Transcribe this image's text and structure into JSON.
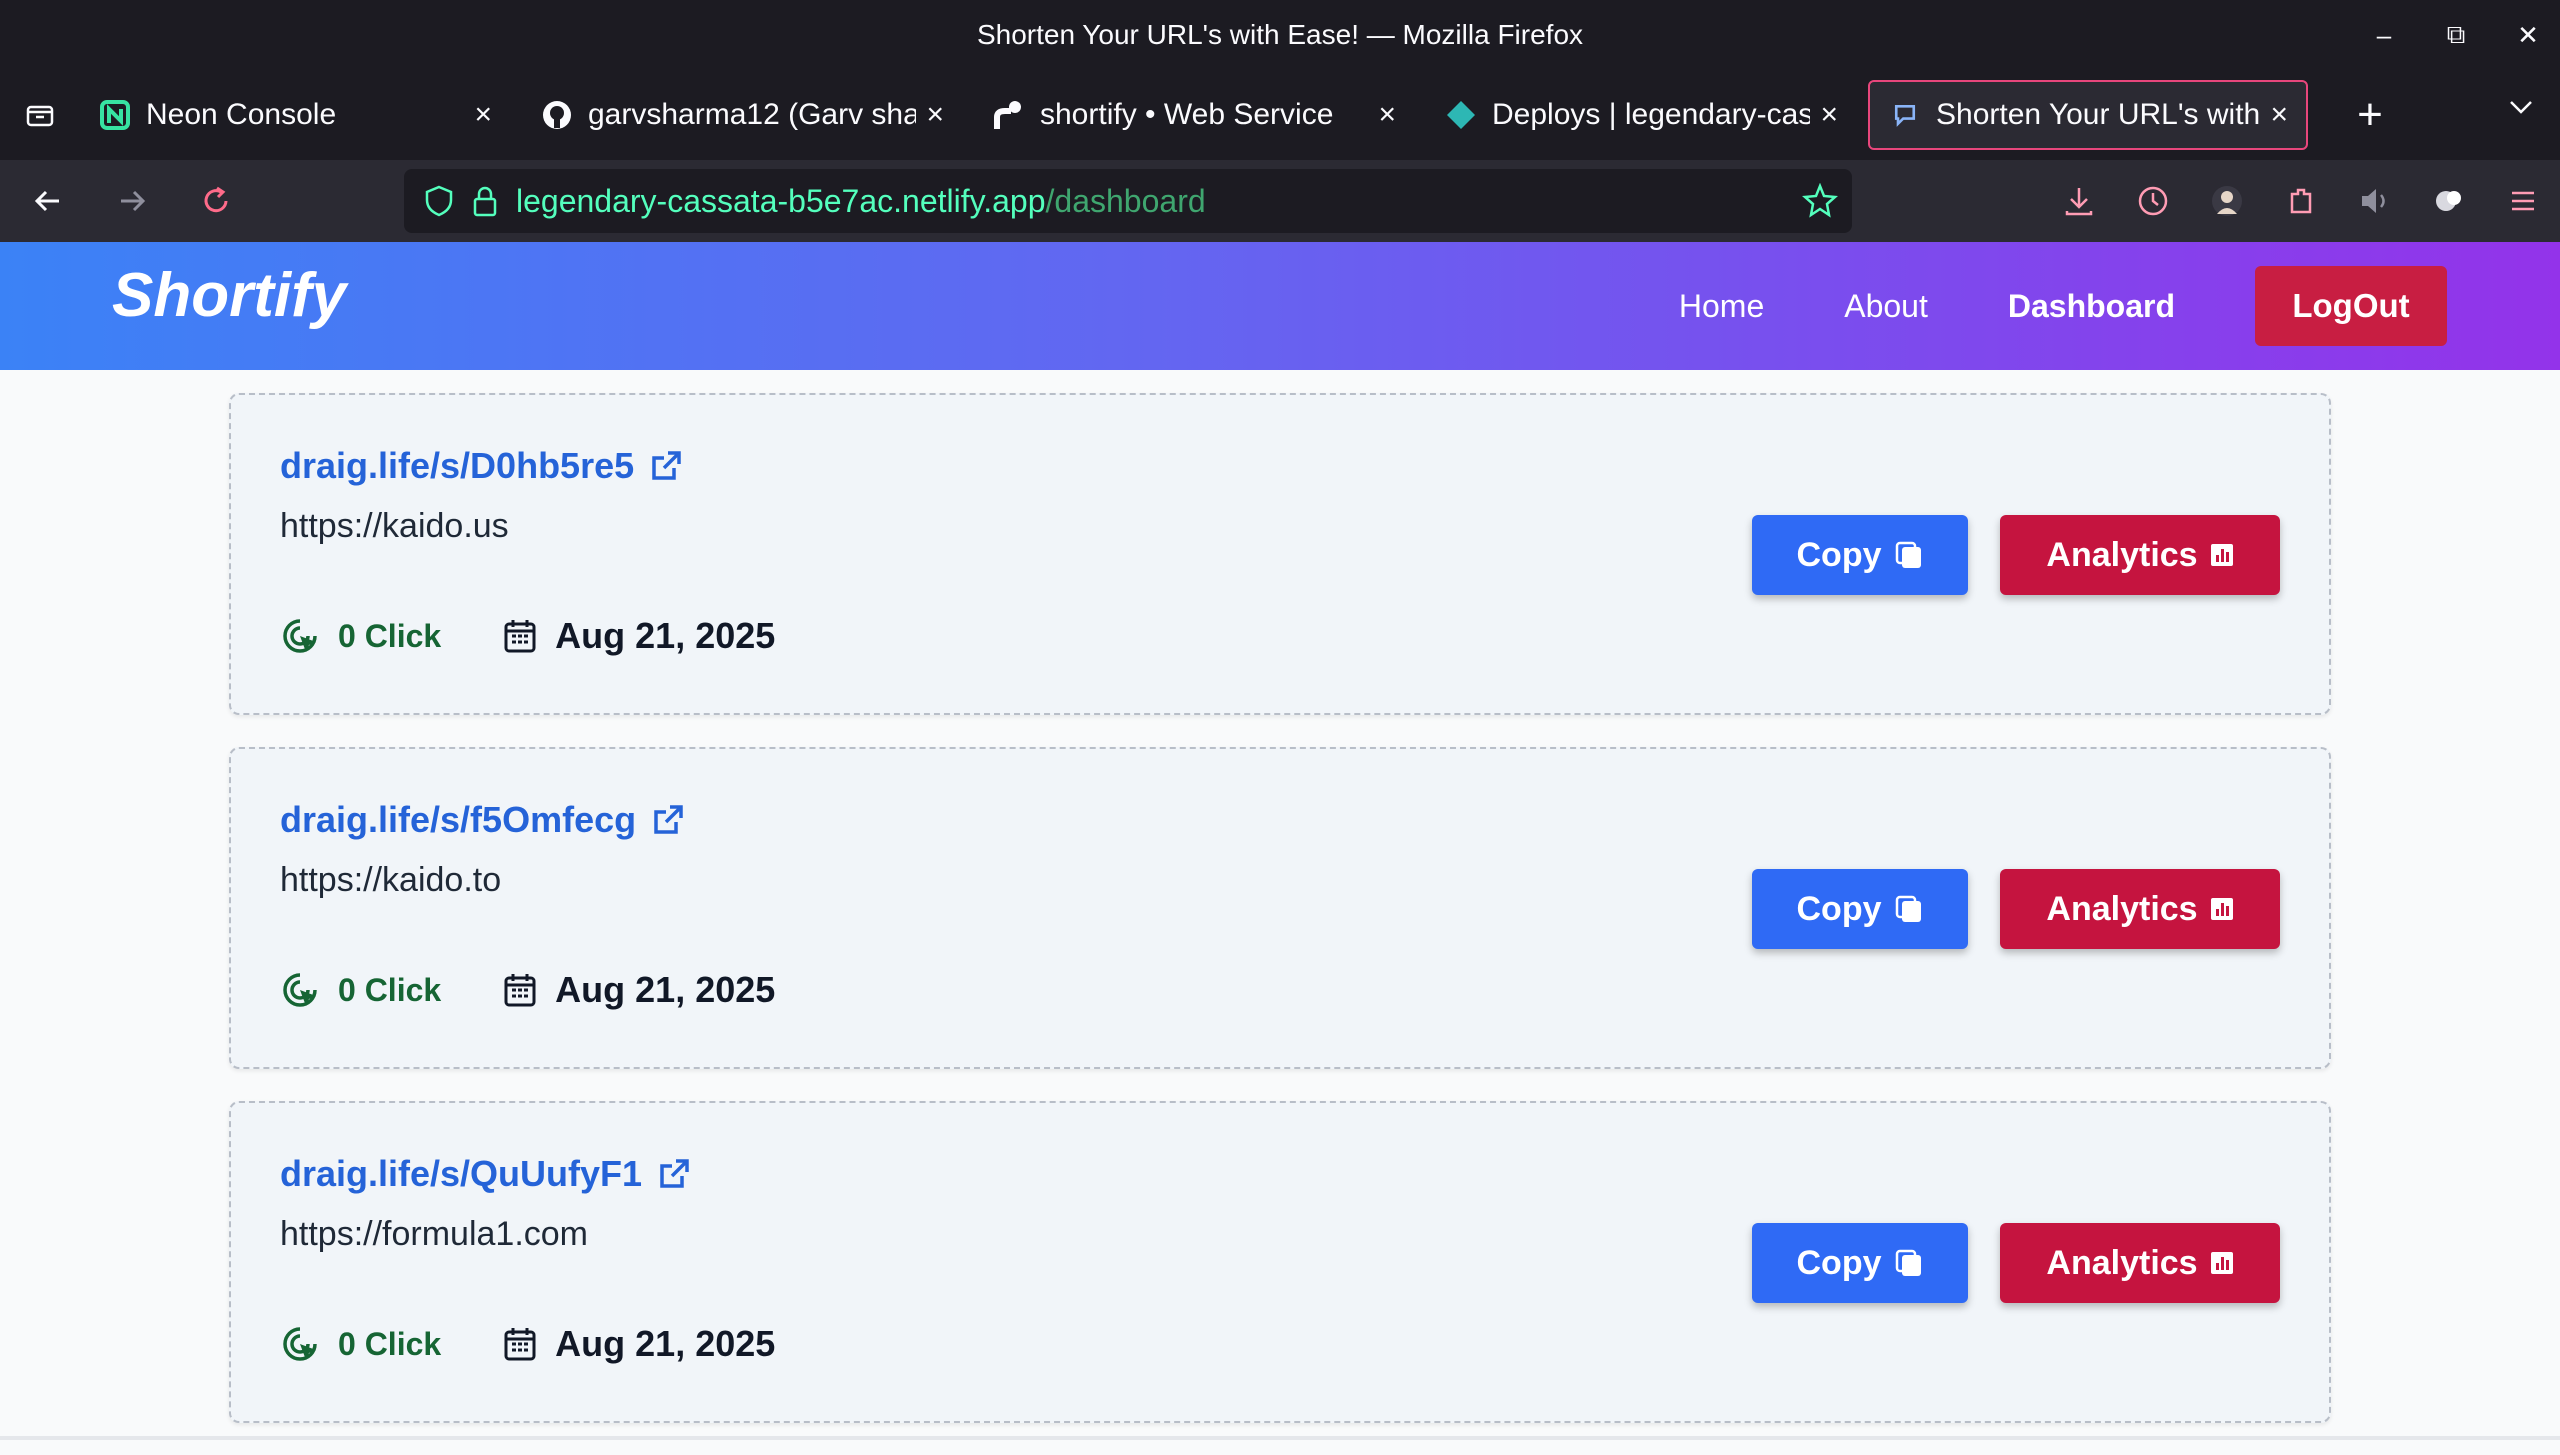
{
  "window": {
    "title": "Shorten Your URL's with Ease! — Mozilla Firefox"
  },
  "tabs": [
    {
      "label": "Neon Console",
      "icon": "neon-icon",
      "active": false
    },
    {
      "label": "garvsharma12 (Garv sha",
      "icon": "github-icon",
      "active": false
    },
    {
      "label": "shortify  •  Web Service",
      "icon": "render-icon",
      "active": false
    },
    {
      "label": "Deploys | legendary-cas",
      "icon": "netlify-icon",
      "active": false
    },
    {
      "label": "Shorten Your URL's with",
      "icon": "shortify-icon",
      "active": true
    }
  ],
  "addressbar": {
    "host": "legendary-cassata-b5e7ac.netlify.app",
    "path": "/dashboard"
  },
  "site": {
    "logo": "Shortify",
    "nav": {
      "home": "Home",
      "about": "About",
      "dashboard": "Dashboard",
      "logout": "LogOut"
    }
  },
  "links": [
    {
      "short": "draig.life/s/D0hb5re5",
      "original": "https://kaido.us",
      "clicks": "0 Click",
      "date": "Aug 21, 2025",
      "copy": "Copy",
      "analytics": "Analytics"
    },
    {
      "short": "draig.life/s/f5Omfecg",
      "original": "https://kaido.to",
      "clicks": "0 Click",
      "date": "Aug 21, 2025",
      "copy": "Copy",
      "analytics": "Analytics"
    },
    {
      "short": "draig.life/s/QuUufyF1",
      "original": "https://formula1.com",
      "clicks": "0 Click",
      "date": "Aug 21, 2025",
      "copy": "Copy",
      "analytics": "Analytics"
    }
  ],
  "colors": {
    "header_gradient_start": "#3b82f6",
    "header_gradient_end": "#9333ea",
    "copy_button": "#2f6af5",
    "analytics_button": "#c5143f",
    "link": "#2563d8",
    "clicks": "#166534"
  }
}
